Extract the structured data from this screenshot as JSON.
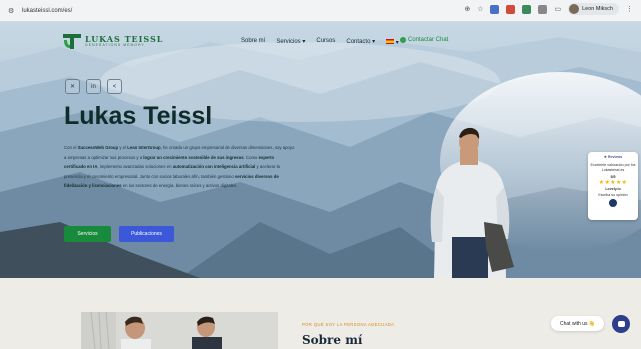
{
  "browser": {
    "url": "lukasteissl.com/es/",
    "profile_name": "Leon Miksch"
  },
  "site": {
    "logo_main": "LUKAS TEISSL",
    "logo_sub": "GENERATIONS MEMORY",
    "nav": {
      "items": [
        "Sobre mí",
        "Servicios ▾",
        "Cursos",
        "Contacto ▾"
      ],
      "language_caret": "▾",
      "contact_cta": "Contactar Chat"
    },
    "socials": [
      {
        "icon": "x-icon",
        "glyph": "✕"
      },
      {
        "icon": "linkedin-icon",
        "glyph": "in"
      },
      {
        "icon": "share-icon",
        "glyph": "<"
      }
    ],
    "title": "Lukas Teissl",
    "intro": {
      "p1": "Con el ",
      "b1": "SuccessWeb Group",
      "p2": " y el ",
      "b2": "Lean InterGroup",
      "p3": ", he creado un grupo empresarial de diversas dimensiones, soy apoyo a empresas a optimizar sus procesos y a ",
      "b3": "lograr un crecimiento sostenible de sus ingresos",
      "p4": ". Como ",
      "b4": "experto certificado en IA",
      "p5": ", implemento avanzadas soluciones en ",
      "b5": "automatización con inteligencia artificial",
      "p6": " y acelerar la presencia y el crecimiento empresarial. Junto con socios laborales afín, también gestiono ",
      "b6": "servicios diversos de fidelización y licenciaciones",
      "p7": " en los sectores de energía, bienes raíces y activos digitales."
    },
    "buttons": {
      "primary": "Servicios",
      "secondary": "Publicaciones"
    },
    "review_widget": {
      "header": "★ Reviews",
      "line1": "Excelente valoración por los",
      "line2": "Lukasteissl.es",
      "score": "5/5",
      "stars": "★★★★★",
      "logo": "Lovely.io",
      "cta": "Escriba su opinión"
    },
    "about": {
      "kicker": "POR QUÉ SOY LA PERSONA ADECUADA",
      "heading": "Sobre mí"
    },
    "chat": {
      "label": "Chat with us 👋"
    }
  },
  "colors": {
    "brand_green": "#178a3c",
    "brand_blue": "#3b58d8",
    "accent_orange": "#d58a1c",
    "text_dark": "#0f2c2a"
  }
}
